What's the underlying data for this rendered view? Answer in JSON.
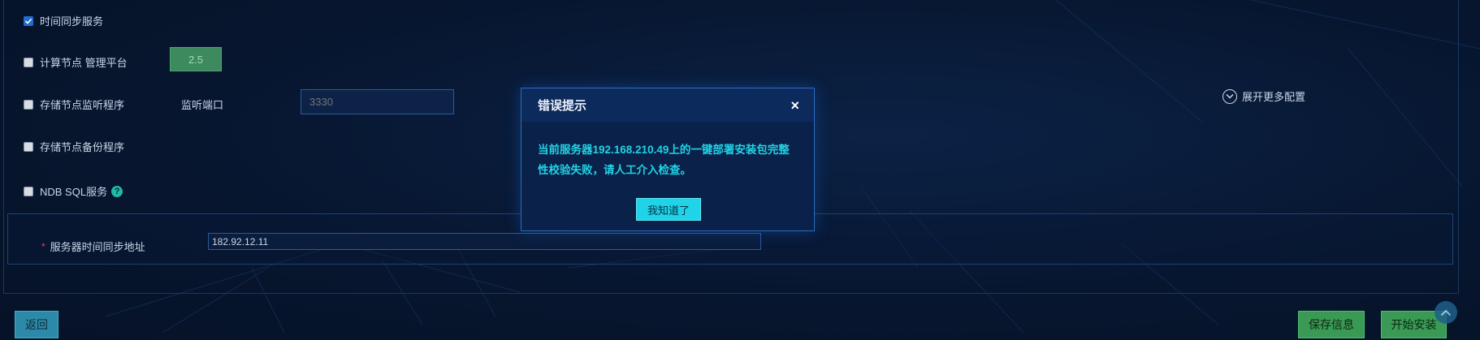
{
  "services": {
    "time_sync": {
      "label": "时间同步服务",
      "checked": true
    },
    "compute_mgmt": {
      "label": "计算节点 管理平台",
      "checked": false,
      "version": "2.5"
    },
    "storage_monitor": {
      "label": "存储节点监听程序",
      "checked": false,
      "port_label": "监听端口",
      "port_placeholder": "3330"
    },
    "storage_backup": {
      "label": "存储节点备份程序",
      "checked": false
    },
    "ndb_sql": {
      "label": "NDB SQL服务",
      "checked": false,
      "help_glyph": "?"
    }
  },
  "expand_more": {
    "label": "展开更多配置",
    "icon": "chevron-down-icon"
  },
  "ntp": {
    "required_mark": "*",
    "label": "服务器时间同步地址",
    "value": "182.92.12.11"
  },
  "footer": {
    "back_label": "返回",
    "save_label": "保存信息",
    "install_label": "开始安装",
    "scroll_top_icon": "chevron-up-icon"
  },
  "modal": {
    "title": "错误提示",
    "close_glyph": "×",
    "message": "当前服务器192.168.210.49上的一键部署安装包完整性校验失败，请人工介入检查。",
    "ok_label": "我知道了"
  },
  "colors": {
    "background": "#07162f",
    "accent_cyan": "#22d3e6",
    "success_green": "#3a9a55",
    "required_red": "#e0474c"
  }
}
